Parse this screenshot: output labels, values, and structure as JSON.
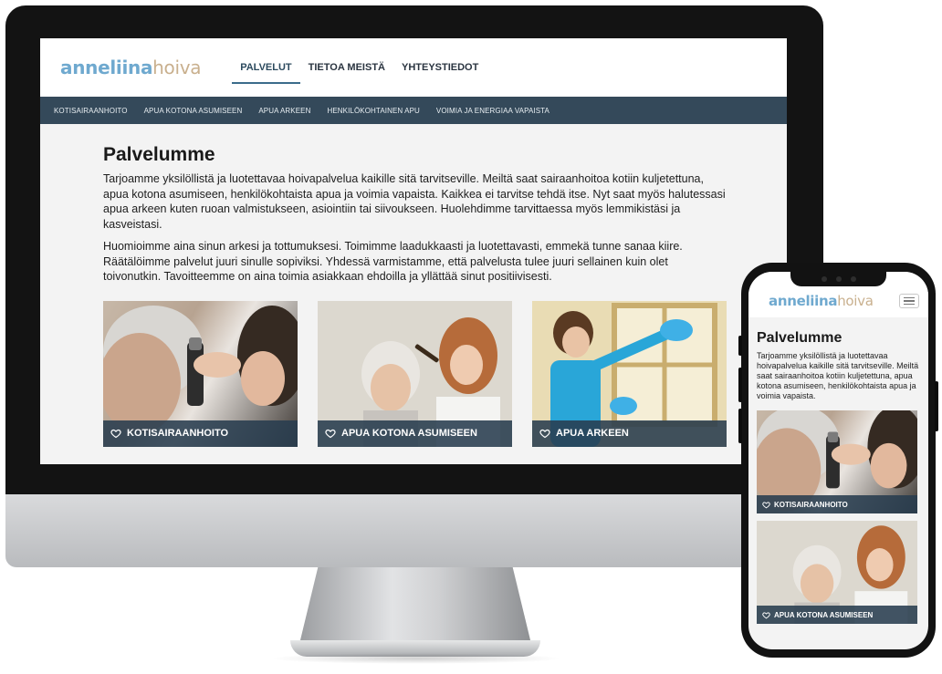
{
  "brand": {
    "logo_part1": "anneliina",
    "logo_part2": "hoiva"
  },
  "desktop": {
    "nav": [
      {
        "label": "PALVELUT",
        "active": true
      },
      {
        "label": "TIETOA MEISTÄ",
        "active": false
      },
      {
        "label": "YHTEYSTIEDOT",
        "active": false
      }
    ],
    "subnav": [
      "KOTISAIRAANHOITO",
      "APUA KOTONA ASUMISEEN",
      "APUA ARKEEN",
      "HENKILÖKOHTAINEN APU",
      "VOIMIA JA ENERGIAA VAPAISTA"
    ],
    "title": "Palvelumme",
    "paragraphs": [
      "Tarjoamme yksilöllistä ja luotettavaa hoivapalvelua kaikille sitä tarvitseville. Meiltä saat sairaanhoitoa kotiin kuljetettuna, apua kotona asumiseen, henkilökohtaista apua ja voimia vapaista. Kaikkea ei tarvitse tehdä itse. Nyt saat myös halutessasi apua arkeen kuten ruoan valmistukseen, asiointiin tai siivoukseen. Huolehdimme tarvittaessa myös lemmikistäsi ja kasveistasi.",
      "Huomioimme aina sinun arkesi ja tottumuksesi. Toimimme laadukkaasti ja luotettavasti, emmekä tunne sanaa kiire. Räätälöimme palvelut juuri sinulle sopiviksi. Yhdessä varmistamme, että palvelusta tulee juuri sellainen kuin olet toivonutkin. Tavoitteemme on aina toimia asiakkaan ehdoilla ja yllättää sinut positiivisesti."
    ],
    "cards": [
      {
        "label": "KOTISAIRAANHOITO",
        "image": "nurse-examining-ear"
      },
      {
        "label": "APUA KOTONA ASUMISEEN",
        "image": "caregiver-combing-elderly-hair"
      },
      {
        "label": "APUA ARKEEN",
        "image": "cleaner-wiping-window"
      }
    ]
  },
  "mobile": {
    "title": "Palvelumme",
    "paragraph": "Tarjoamme yksilöllistä ja luotettavaa hoivapalvelua kaikille sitä tarvitseville. Meiltä saat sairaanhoitoa kotiin kuljetettuna, apua kotona asumiseen, henkilökohtaista apua ja voimia vapaista.",
    "cards": [
      {
        "label": "KOTISAIRAANHOITO"
      },
      {
        "label": "APUA KOTONA ASUMISEEN"
      }
    ]
  },
  "colors": {
    "brand_blue": "#6fa9cf",
    "brand_tan": "#c9b08e",
    "subnav_bg": "#34495a",
    "caption_bg": "#283c4e"
  },
  "icons": {
    "card_icon": "heart-outline-icon",
    "menu_icon": "hamburger-menu-icon"
  }
}
